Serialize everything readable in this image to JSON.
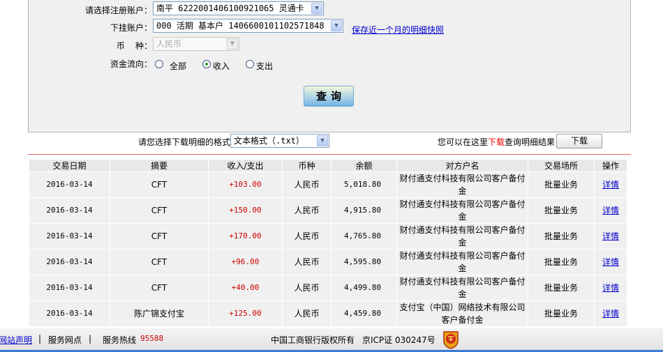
{
  "form": {
    "account_label": "请选择注册账户：",
    "account_value": "南平  6222001406100921065 灵通卡",
    "sub_account_label": "下挂账户：",
    "sub_account_value": "000 活期 基本户 1406600101102571848",
    "save_link": "保存近一个月的明细快照",
    "currency_label": "币    种：",
    "currency_value": "人民币",
    "flow_label": "资金流向：",
    "flow_options": [
      "全部",
      "收入",
      "支出"
    ],
    "flow_selected": "收入",
    "query_button": "查询"
  },
  "download": {
    "format_label": "请您选择下载明细的格式",
    "format_value": "文本格式（.txt）",
    "hint_prefix": "您可以在这里",
    "hint_highlight": "下载",
    "hint_suffix": "查询明细结果",
    "button": "下载"
  },
  "table": {
    "headers": [
      "交易日期",
      "摘要",
      "收入/支出",
      "币种",
      "余额",
      "对方户名",
      "交易场所",
      "操作"
    ],
    "rows": [
      {
        "date": "2016-03-14",
        "summary": "CFT",
        "amount": "+103.00",
        "currency": "人民币",
        "balance": "5,018.80",
        "counterparty": "财付通支付科技有限公司客户备付金",
        "place": "批量业务",
        "action": "详情"
      },
      {
        "date": "2016-03-14",
        "summary": "CFT",
        "amount": "+150.00",
        "currency": "人民币",
        "balance": "4,915.80",
        "counterparty": "财付通支付科技有限公司客户备付金",
        "place": "批量业务",
        "action": "详情"
      },
      {
        "date": "2016-03-14",
        "summary": "CFT",
        "amount": "+170.00",
        "currency": "人民币",
        "balance": "4,765.80",
        "counterparty": "财付通支付科技有限公司客户备付金",
        "place": "批量业务",
        "action": "详情"
      },
      {
        "date": "2016-03-14",
        "summary": "CFT",
        "amount": "+96.00",
        "currency": "人民币",
        "balance": "4,595.80",
        "counterparty": "财付通支付科技有限公司客户备付金",
        "place": "批量业务",
        "action": "详情"
      },
      {
        "date": "2016-03-14",
        "summary": "CFT",
        "amount": "+40.00",
        "currency": "人民币",
        "balance": "4,499.80",
        "counterparty": "财付通支付科技有限公司客户备付金",
        "place": "批量业务",
        "action": "详情"
      },
      {
        "date": "2016-03-14",
        "summary": "陈广锦支付宝",
        "amount": "+125.00",
        "currency": "人民币",
        "balance": "4,459.80",
        "counterparty": "支付宝（中国）网络技术有限公司客户备付金",
        "place": "批量业务",
        "action": "详情"
      }
    ]
  },
  "footer": {
    "statement": "网站声明",
    "branches": "服务网点",
    "hotline_label": "服务热线",
    "hotline": "95588",
    "copyright": "中国工商银行版权所有",
    "icp": "京ICP证 030247号"
  },
  "colors": {
    "accent_red": "#cc0000",
    "link": "#0000cc",
    "footer_bar": "#3b7bd4"
  }
}
